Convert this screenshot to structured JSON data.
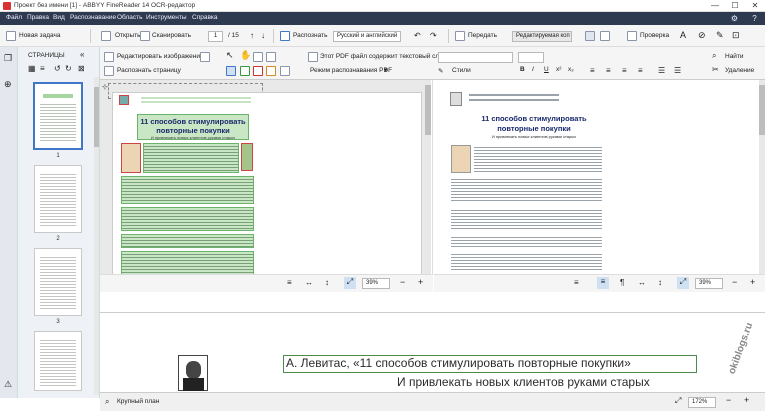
{
  "window": {
    "title": "Проект без имени [1] - ABBYY FineReader 14 OCR-редактор"
  },
  "menu": [
    "Файл",
    "Правка",
    "Вид",
    "Распознавание",
    "Область",
    "Инструменты",
    "Справка"
  ],
  "toolbar": {
    "new_task": "Новая задача",
    "open": "Открыть",
    "scan": "Сканировать",
    "page_current": "1",
    "page_total": "/ 15",
    "recognize": "Распознать",
    "language": "Русский и английский",
    "send": "Передать",
    "mode": "Редактируемая коп",
    "check": "Проверка"
  },
  "pages_panel": {
    "title": "СТРАНИЦЫ",
    "page_numbers": [
      "1",
      "2",
      "3"
    ]
  },
  "image_toolbar": {
    "edit_image": "Редактировать изображение",
    "recognize_page": "Распознать страницу",
    "pdf_note": "Этот PDF файл содержит текстовый слой",
    "pdf_mode": "Режим распознавания PDF",
    "styles": "Стили",
    "find": "Найти",
    "delete": "Удаление"
  },
  "doc": {
    "title_line1": "11 способов стимулировать",
    "title_line2": "повторные покупки",
    "subtitle": "И привлекать новых клиентов руками старых"
  },
  "zoom": {
    "image": "39%",
    "text": "39%",
    "status": "172%"
  },
  "closeup": {
    "line1": "А. Левитас, «11 способов стимулировать повторные покупки»",
    "line2": "И привлекать новых клиентов руками старых"
  },
  "status": {
    "closeup_label": "Крупный план"
  },
  "watermark": "okiblogs.ru"
}
